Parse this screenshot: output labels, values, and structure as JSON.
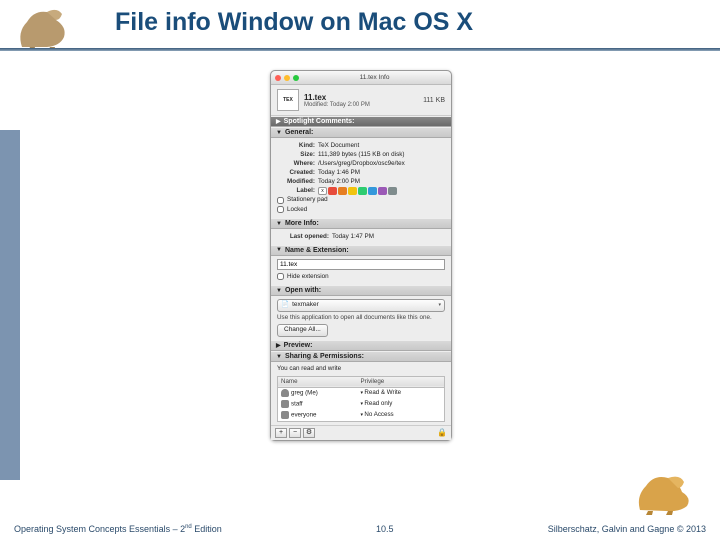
{
  "slide": {
    "title": "File info Window on Mac OS X",
    "footer_left": "Operating System Concepts Essentials – 2",
    "footer_left_sup": "nd",
    "footer_left_tail": " Edition",
    "page_num": "10.5",
    "footer_right": "Silberschatz, Galvin and Gagne © 2013"
  },
  "window": {
    "title": "11.tex Info",
    "file_name": "11.tex",
    "file_size_hdr": "111 KB",
    "file_modified_hdr": "Modified: Today 2:00 PM",
    "tex_label": "TEX",
    "sections": {
      "spotlight": "Spotlight Comments:",
      "general": "General:",
      "moreinfo": "More Info:",
      "name_ext": "Name & Extension:",
      "open_with": "Open with:",
      "preview": "Preview:",
      "sharing": "Sharing & Permissions:"
    },
    "general": {
      "kind_k": "Kind:",
      "kind_v": "TeX Document",
      "size_k": "Size:",
      "size_v": "111,389 bytes (115 KB on disk)",
      "where_k": "Where:",
      "where_v": "/Users/greg/Dropbox/osc9e/tex",
      "created_k": "Created:",
      "created_v": "Today 1:46 PM",
      "modified_k": "Modified:",
      "modified_v": "Today 2:00 PM",
      "label_k": "Label:",
      "stationery": "Stationery pad",
      "locked": "Locked"
    },
    "moreinfo": {
      "lastopened_k": "Last opened:",
      "lastopened_v": "Today 1:47 PM"
    },
    "name_ext": {
      "value": "11.tex",
      "hide_ext": "Hide extension"
    },
    "open_with": {
      "app": "texmaker",
      "desc": "Use this application to open all documents like this one.",
      "change_all": "Change All..."
    },
    "sharing": {
      "caption": "You can read and write",
      "col_name": "Name",
      "col_priv": "Privilege",
      "rows": [
        {
          "name": "greg (Me)",
          "priv": "Read & Write"
        },
        {
          "name": "staff",
          "priv": "Read only"
        },
        {
          "name": "everyone",
          "priv": "No Access"
        }
      ]
    }
  }
}
